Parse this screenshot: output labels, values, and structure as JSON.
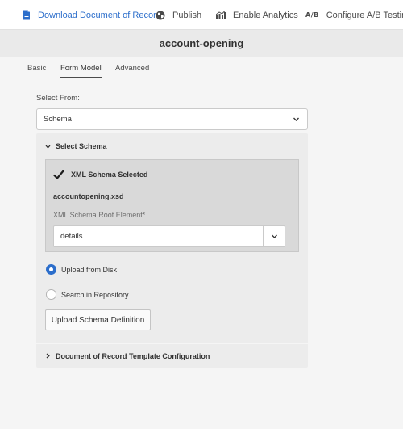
{
  "toolbar": {
    "download_label": "Download Document of Record",
    "publish_label": "Publish",
    "analytics_label": "Enable Analytics",
    "ab_icon_text": "A/B",
    "ab_label": "Configure A/B Testing"
  },
  "title": "account-opening",
  "tabs": [
    {
      "label": "Basic",
      "active": false
    },
    {
      "label": "Form Model",
      "active": true
    },
    {
      "label": "Advanced",
      "active": false
    }
  ],
  "form": {
    "select_from_label": "Select From:",
    "select_from_value": "Schema",
    "select_schema_header": "Select Schema",
    "schema_selected_text": "XML Schema Selected",
    "file_name": "accountopening.xsd",
    "root_element_label": "XML Schema Root Element*",
    "root_element_value": "details",
    "radio_options": [
      {
        "label": "Upload from Disk",
        "selected": true
      },
      {
        "label": "Search in Repository",
        "selected": false
      }
    ],
    "upload_button_label": "Upload Schema Definition",
    "dor_section_header": "Document of Record Template Configuration"
  },
  "colors": {
    "accent": "#2c6ecb",
    "link": "#2c6ecb"
  },
  "icons": {
    "download": "document-icon",
    "publish": "globe-icon",
    "analytics": "bar-chart-icon",
    "select_chevron": "chevron-down-icon",
    "accordion_open": "chevron-down-icon",
    "accordion_closed": "chevron-right-icon",
    "schema_selected": "checkmark-icon"
  }
}
